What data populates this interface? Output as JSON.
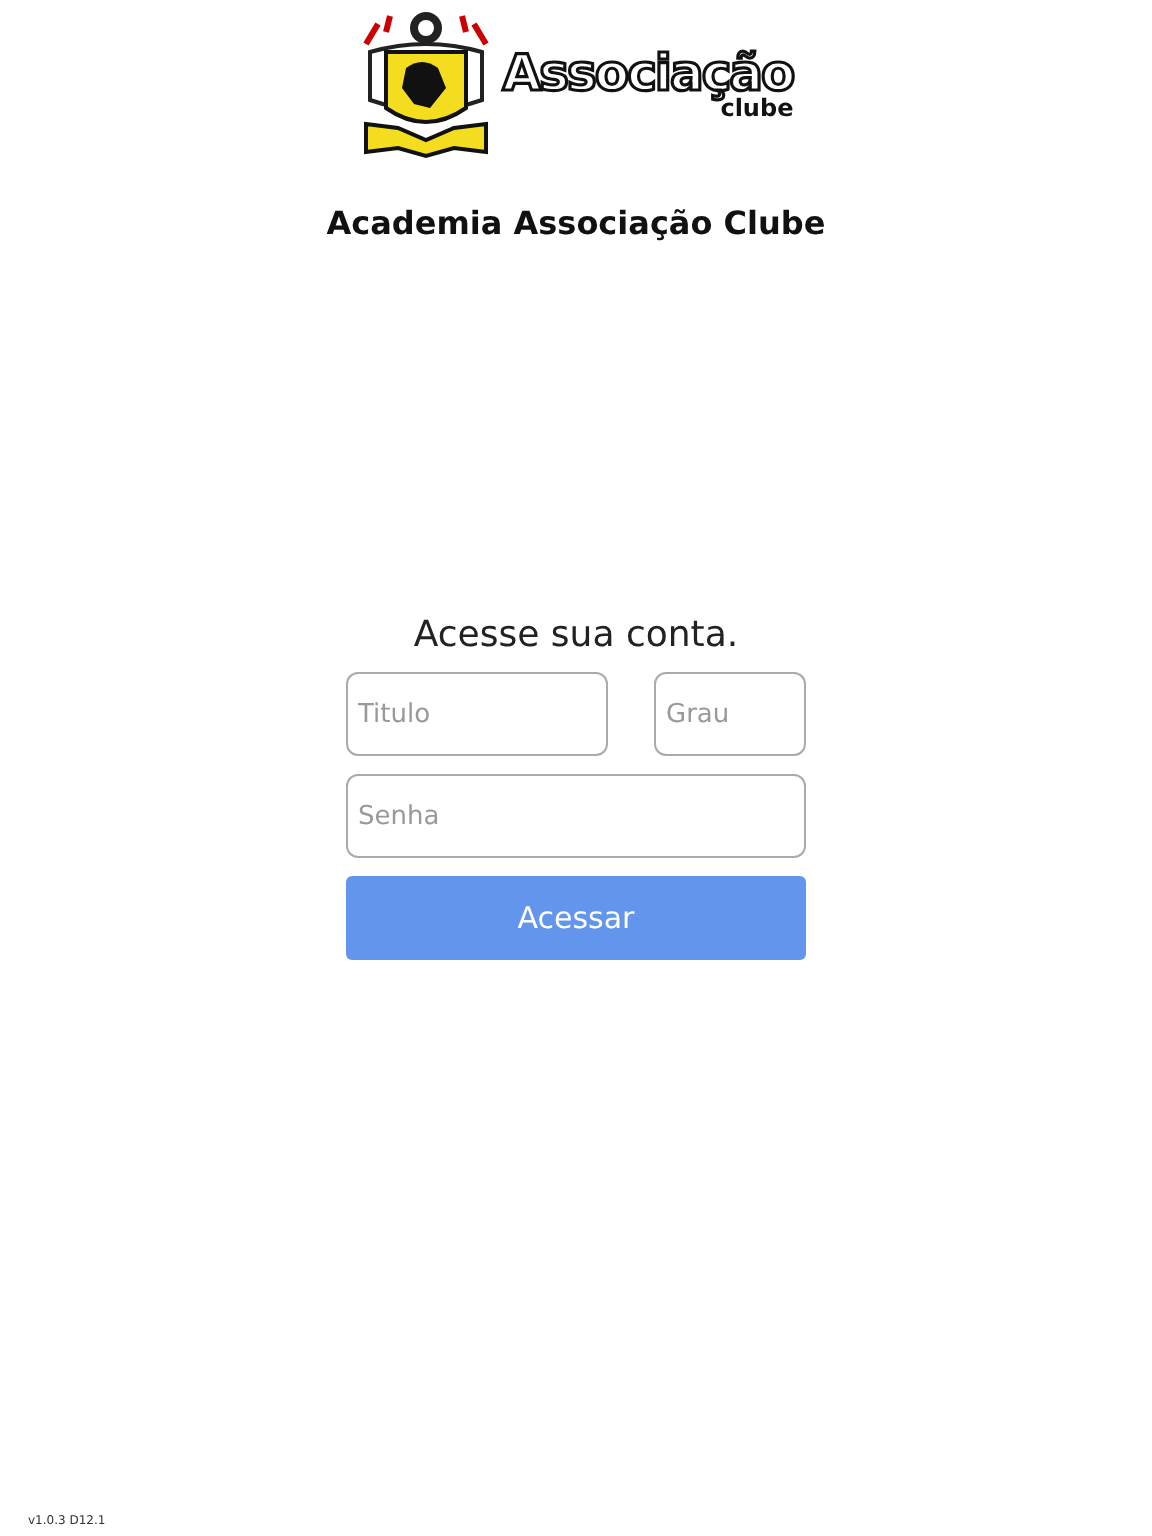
{
  "logo": {
    "name": "Associação",
    "subtitle": "clube"
  },
  "app_title": "Academia Associação Clube",
  "login": {
    "heading": "Acesse sua conta.",
    "fields": [
      {
        "placeholder": "Titulo"
      },
      {
        "placeholder": "Grau"
      },
      {
        "placeholder": "Senha"
      }
    ],
    "button": "Acessar"
  },
  "version": "v1.0.3 D12.1"
}
